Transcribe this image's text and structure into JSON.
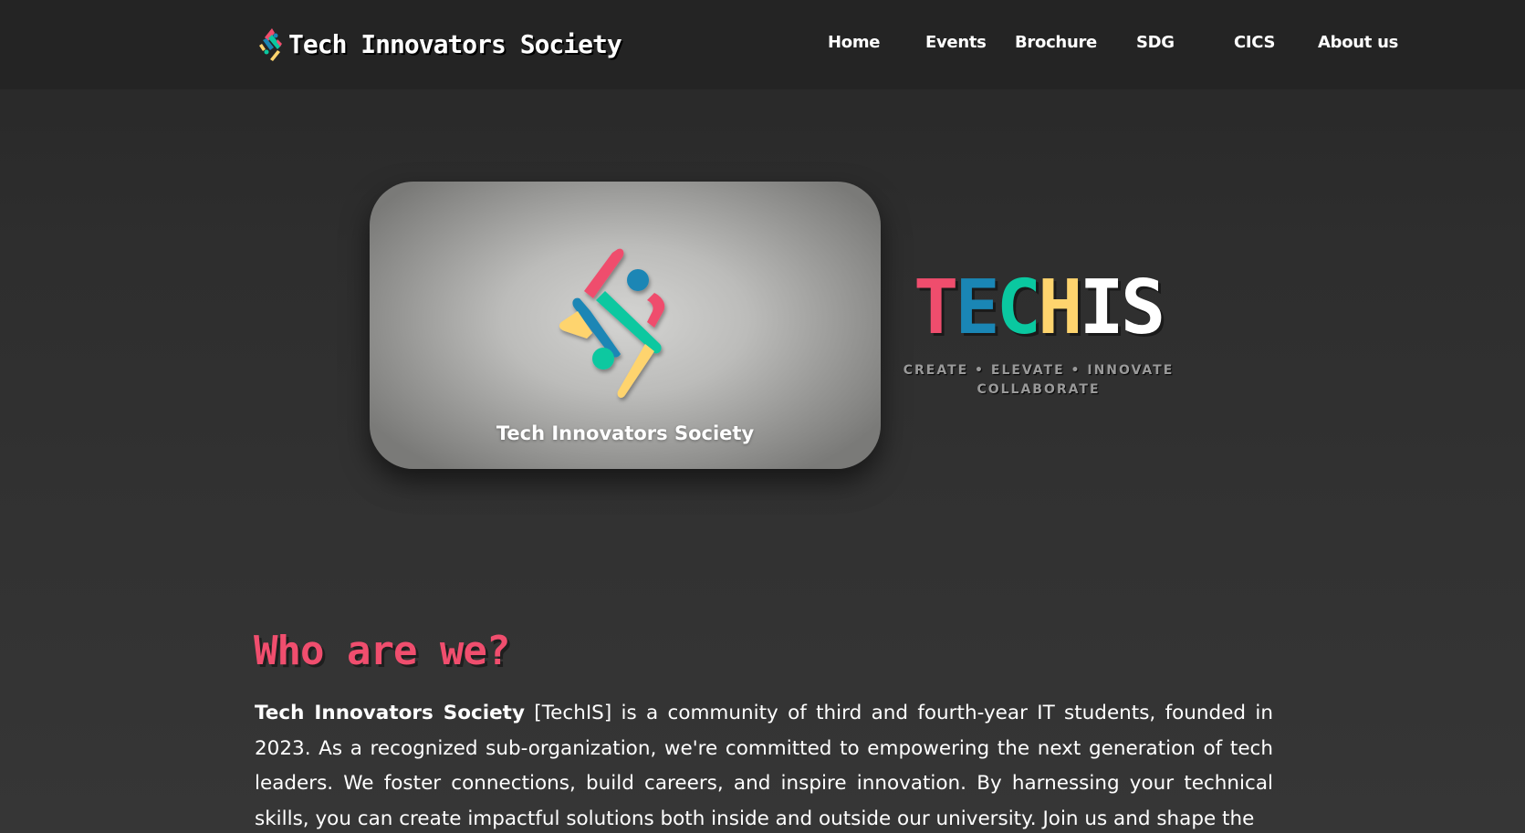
{
  "brand": {
    "name": "Tech Innovators Society",
    "logo_icon": "techis-logo-icon"
  },
  "nav": {
    "items": [
      {
        "label": "Home"
      },
      {
        "label": "Events"
      },
      {
        "label": "Brochure"
      },
      {
        "label": "SDG"
      },
      {
        "label": "CICS"
      },
      {
        "label": "About us"
      }
    ]
  },
  "hero": {
    "card_title": "Tech Innovators Society",
    "wordmark": {
      "letters": [
        {
          "char": "T",
          "color": "#ef4d6d"
        },
        {
          "char": "E",
          "color": "#1a86b5"
        },
        {
          "char": "C",
          "color": "#0ac8a0"
        },
        {
          "char": "H",
          "color": "#fed46e"
        },
        {
          "char": "I",
          "color": "#ffffff"
        },
        {
          "char": "S",
          "color": "#ffffff"
        }
      ]
    },
    "tagline_line1": "CREATE • ELEVATE • INNOVATE",
    "tagline_line2": "COLLABORATE"
  },
  "about": {
    "title": "Who are we?",
    "org_name": "Tech Innovators Society",
    "body": " [TechIS] is a community of third and fourth-year IT students, founded in 2023. As a recognized sub-organization, we're committed to empowering the next generation of tech leaders. We foster connections, build careers, and inspire innovation. By harnessing your technical skills, you can create impactful solutions both inside and outside our university. Join us and shape the"
  },
  "colors": {
    "pink": "#ef4d6d",
    "blue": "#1a86b5",
    "teal": "#0ac8a0",
    "yellow": "#fed46e",
    "background": "#333333",
    "header": "#242424"
  }
}
